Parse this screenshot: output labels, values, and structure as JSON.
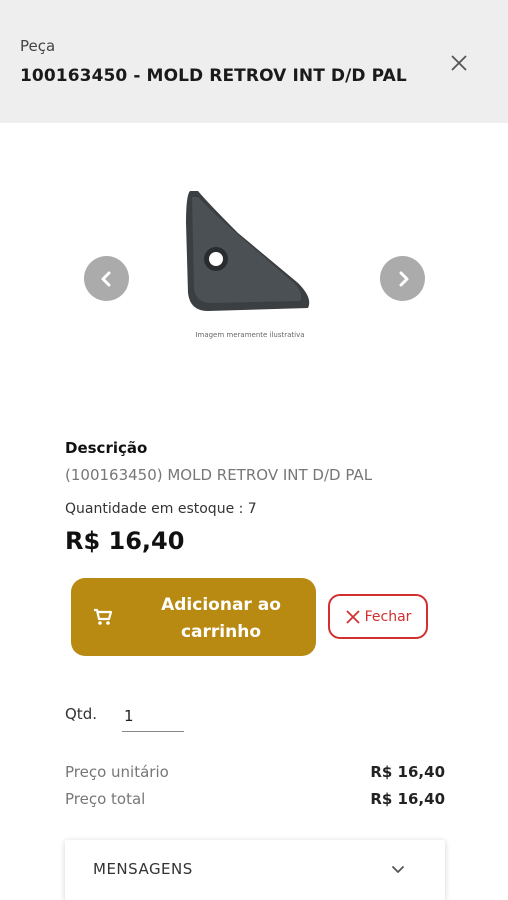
{
  "header": {
    "kind": "Peça",
    "title": "100163450 - MOLD RETROV INT D/D PAL"
  },
  "gallery": {
    "caption": "Imagem meramente ilustrativa"
  },
  "product": {
    "description_label": "Descrição",
    "description": "(100163450) MOLD RETROV INT D/D PAL",
    "stock_label": "Quantidade em estoque :",
    "stock_value": "7",
    "price": "R$ 16,40"
  },
  "actions": {
    "add_to_cart_label": "Adicionar ao carrinho",
    "close_label": "Fechar"
  },
  "quantity": {
    "label": "Qtd.",
    "value": "1"
  },
  "pricing": {
    "unit_label": "Preço unitário",
    "unit_value": "R$ 16,40",
    "total_label": "Preço total",
    "total_value": "R$ 16,40"
  },
  "messages": {
    "label": "MENSAGENS"
  },
  "colors": {
    "accent": "#b98a12",
    "danger": "#d32f2f",
    "header_bg": "#eeeeee",
    "nav_button": "#ababab"
  },
  "icons": {
    "close": "close-icon",
    "prev": "chevron-left-icon",
    "next": "chevron-right-icon",
    "cart": "cart-icon",
    "expand": "chevron-down-icon"
  }
}
